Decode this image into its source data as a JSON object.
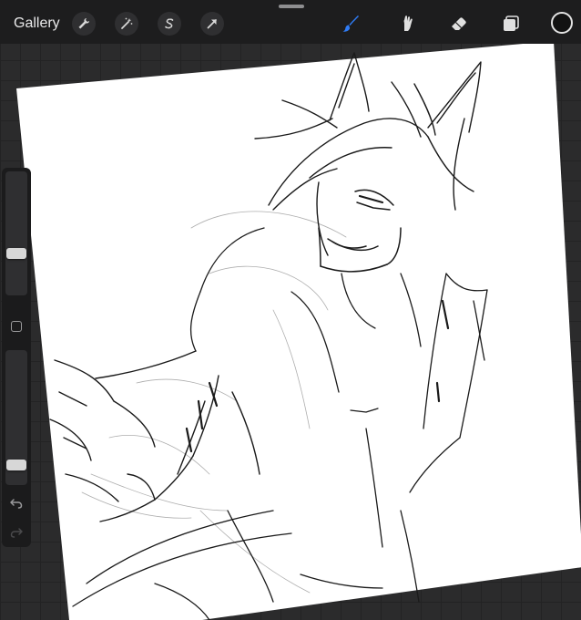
{
  "topbar": {
    "gallery_label": "Gallery",
    "left_tools": [
      "actions-wrench-icon",
      "adjustments-magic-wand-icon",
      "selection-s-icon",
      "transform-arrow-icon"
    ],
    "right_tools": [
      "brush-icon",
      "smudge-icon",
      "eraser-icon",
      "layers-icon",
      "color-swatch"
    ]
  },
  "colors": {
    "brush_active": "#2f7cf6",
    "current_color": "#121212",
    "canvas": "#ffffff",
    "toolbar": "#1d1d1e"
  },
  "sidebar": {
    "brush_size_level": 0.32,
    "opacity_level": 0.12,
    "icons": [
      "modify-square-icon",
      "undo-icon",
      "redo-icon"
    ]
  }
}
